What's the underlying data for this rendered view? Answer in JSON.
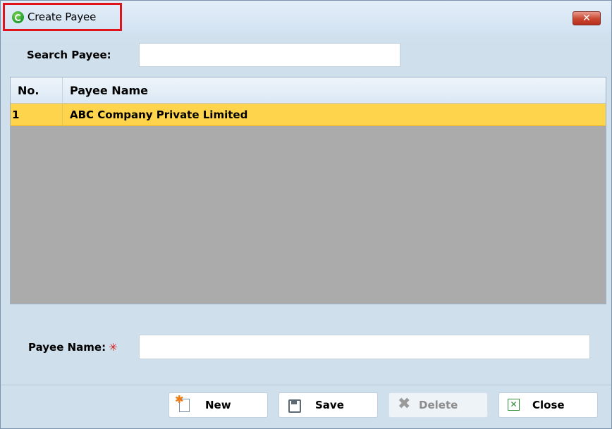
{
  "window": {
    "title": "Create Payee",
    "close_glyph": "✕"
  },
  "search": {
    "label": "Search Payee:",
    "value": "",
    "placeholder": ""
  },
  "grid": {
    "columns": [
      "No.",
      "Payee Name"
    ],
    "rows": [
      {
        "no": "1",
        "payee_name": "ABC Company Private Limited"
      }
    ]
  },
  "form": {
    "payee_name_label": "Payee Name:",
    "required_marker": "✳",
    "payee_name_value": ""
  },
  "buttons": {
    "new_label": "New",
    "save_label": "Save",
    "delete_label": "Delete",
    "close_label": "Close"
  },
  "icons": {
    "app": "app-logo-icon",
    "new": "new-document-icon",
    "save": "floppy-disk-icon",
    "delete": "delete-x-icon",
    "close": "excel-close-icon"
  },
  "colors": {
    "selected_row": "#fdd44b",
    "grid_empty_area": "#ababab",
    "title_highlight_border": "#e0151b",
    "close_button": "#c9462f",
    "required_marker": "#d21b1b"
  }
}
